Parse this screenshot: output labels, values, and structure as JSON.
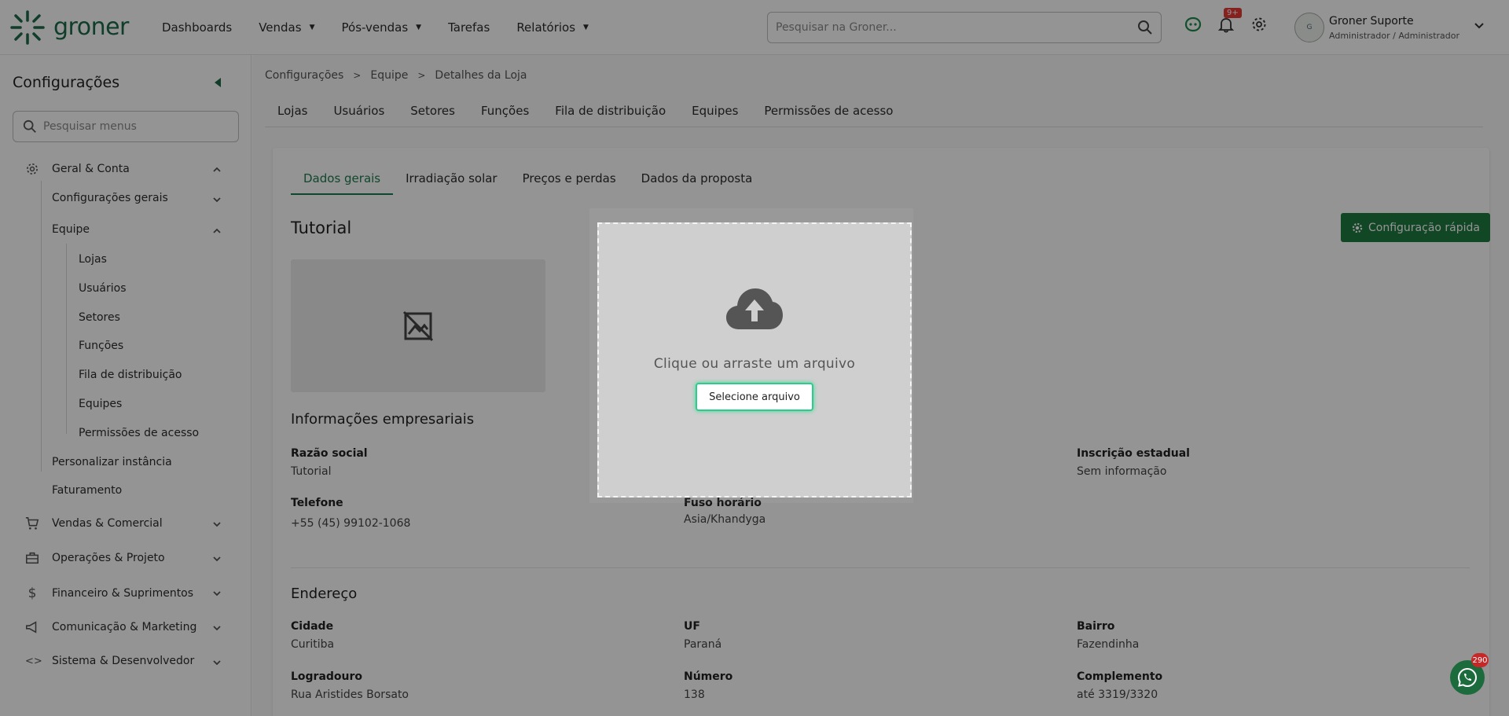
{
  "header": {
    "logo_text": "groner",
    "nav": [
      {
        "label": "Dashboards",
        "has_caret": false
      },
      {
        "label": "Vendas",
        "has_caret": true
      },
      {
        "label": "Pós-vendas",
        "has_caret": true
      },
      {
        "label": "Tarefas",
        "has_caret": false
      },
      {
        "label": "Relatórios",
        "has_caret": true
      }
    ],
    "search_placeholder": "Pesquisar na Groner...",
    "notification_badge": "9+",
    "user_name": "Groner Suporte",
    "user_role": "Administrador / Administrador"
  },
  "sidebar": {
    "title": "Configurações",
    "search_placeholder": "Pesquisar menus",
    "items": {
      "geral": "Geral & Conta",
      "config_gerais": "Configurações gerais",
      "equipe": "Equipe",
      "lojas": "Lojas",
      "usuarios": "Usuários",
      "setores": "Setores",
      "funcoes": "Funções",
      "fila": "Fila de distribuição",
      "equipes": "Equipes",
      "permissoes": "Permissões de acesso",
      "personalizar": "Personalizar instância",
      "faturamento": "Faturamento",
      "vendas": "Vendas & Comercial",
      "operacoes": "Operações & Projeto",
      "financeiro": "Financeiro & Suprimentos",
      "comunicacao": "Comunicação & Marketing",
      "sistema": "Sistema & Desenvolvedor"
    }
  },
  "breadcrumb": [
    "Configurações",
    "Equipe",
    "Detalhes da Loja"
  ],
  "top_tabs": [
    "Lojas",
    "Usuários",
    "Setores",
    "Funções",
    "Fila de distribuição",
    "Equipes",
    "Permissões de acesso"
  ],
  "inner_tabs": [
    "Dados gerais",
    "Irradiação solar",
    "Preços e perdas",
    "Dados da proposta"
  ],
  "store": {
    "title": "Tutorial",
    "quick_config": "Configuração rápida",
    "section_company": "Informações empresariais",
    "razao_label": "Razão social",
    "razao_value": "Tutorial",
    "ie_label": "Inscrição estadual",
    "ie_value": "Sem informação",
    "telefone_label": "Telefone",
    "telefone_value": "+55 (45) 99102-1068",
    "fuso_label": "Fuso horário",
    "fuso_value": "Asia/Khandyga",
    "section_address": "Endereço",
    "cidade_label": "Cidade",
    "cidade_value": "Curitiba",
    "uf_label": "UF",
    "uf_value": "Paraná",
    "bairro_label": "Bairro",
    "bairro_value": "Fazendinha",
    "logradouro_label": "Logradouro",
    "logradouro_value": "Rua Aristides Borsato",
    "numero_label": "Número",
    "numero_value": "138",
    "complemento_label": "Complemento",
    "complemento_value": "até 3319/3320"
  },
  "upload": {
    "text": "Clique ou arraste um arquivo",
    "button": "Selecione arquivo"
  },
  "whatsapp_badge": "290",
  "colors": {
    "brand": "#1c6b4a",
    "accent": "#1f7a43",
    "badge": "#e53935"
  }
}
